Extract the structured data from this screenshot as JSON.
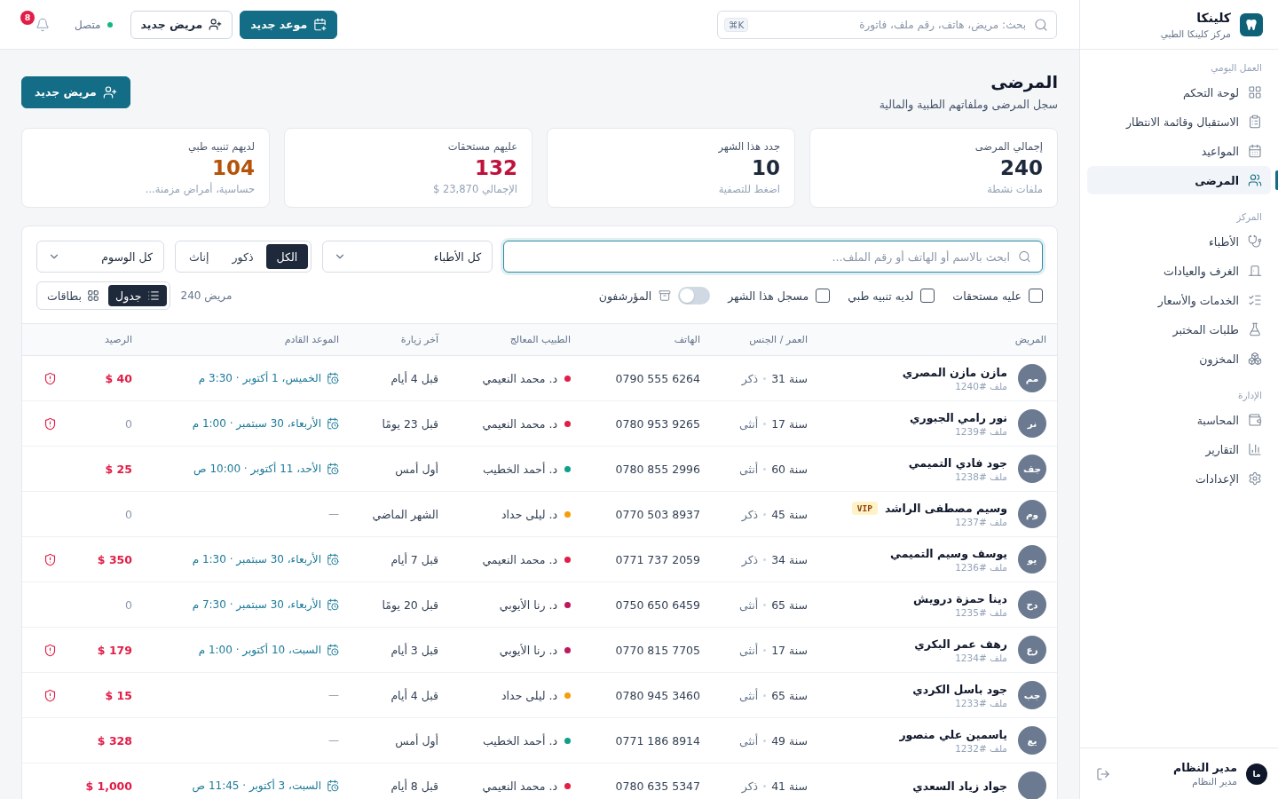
{
  "sidebar": {
    "brand": {
      "title": "كلينكا",
      "subtitle": "مركز كلينكا الطبي"
    },
    "sections": [
      {
        "title": "العمل اليومي",
        "items": [
          {
            "label": "لوحة التحكم",
            "selected": false
          },
          {
            "label": "الاستقبال وقائمة الانتظار",
            "selected": false
          },
          {
            "label": "المواعيد",
            "selected": false
          },
          {
            "label": "المرضى",
            "selected": true
          }
        ]
      },
      {
        "title": "المركز",
        "items": [
          {
            "label": "الأطباء",
            "selected": false
          },
          {
            "label": "الغرف والعيادات",
            "selected": false
          },
          {
            "label": "الخدمات والأسعار",
            "selected": false
          },
          {
            "label": "طلبات المختبر",
            "selected": false
          },
          {
            "label": "المخزون",
            "selected": false
          }
        ]
      },
      {
        "title": "الإدارة",
        "items": [
          {
            "label": "المحاسبة",
            "selected": false
          },
          {
            "label": "التقارير",
            "selected": false
          },
          {
            "label": "الإعدادات",
            "selected": false
          }
        ]
      }
    ],
    "user": {
      "initials": "ما",
      "name": "مدير النظام",
      "role": "مدير النظام"
    }
  },
  "topbar": {
    "search": {
      "placeholder": "بحث: مريض، هاتف، رقم ملف، فاتورة",
      "shortcut": "⌘K"
    },
    "buttons": [
      {
        "label": "موعد جديد",
        "kind": "primary"
      },
      {
        "label": "مريض جديد",
        "kind": "outline"
      }
    ],
    "status": {
      "label": "متصل",
      "online": true
    },
    "notifications": {
      "count": "8"
    }
  },
  "page": {
    "title": "المرضى",
    "subtitle": "سجل المرضى وملفاتهم الطبية والمالية",
    "action": {
      "label": "مريض جديد",
      "kind": "primary"
    }
  },
  "stats": [
    {
      "label": "إجمالي المرضى",
      "value": "240",
      "note": "ملفات نشطة",
      "color": "#1e293b"
    },
    {
      "label": "جدد هذا الشهر",
      "value": "10",
      "note": "اضغط للتصفية",
      "color": "#1e293b"
    },
    {
      "label": "عليهم مستحقات",
      "value": "132",
      "note": "الإجمالي 23,870 $",
      "color": "#be123c"
    },
    {
      "label": "لديهم تنبيه طبي",
      "value": "104",
      "note": "حساسية، أمراض مزمنة...",
      "color": "#b45309"
    }
  ],
  "filters": {
    "search": {
      "placeholder": "ابحث بالاسم أو الهاتف أو رقم الملف...",
      "focused": true
    },
    "doctor_select": {
      "value": "كل الأطباء"
    },
    "gender": [
      {
        "label": "الكل",
        "selected": true
      },
      {
        "label": "ذكور",
        "selected": false
      },
      {
        "label": "إناث",
        "selected": false
      }
    ],
    "tag_select": {
      "value": "كل الوسوم"
    },
    "checks": [
      {
        "label": "عليه مستحقات",
        "checked": false
      },
      {
        "label": "لديه تنبيه طبي",
        "checked": false
      },
      {
        "label": "مسجل هذا الشهر",
        "checked": false
      }
    ],
    "archived": {
      "label": "المؤرشفون",
      "on": false
    },
    "count": "240 مريض",
    "views": [
      {
        "label": "جدول",
        "selected": true
      },
      {
        "label": "بطاقات",
        "selected": false
      }
    ]
  },
  "table": {
    "columns": [
      "المريض",
      "العمر / الجنس",
      "الهاتف",
      "الطبيب المعالج",
      "آخر زيارة",
      "الموعد القادم",
      "الرصيد"
    ],
    "rows": [
      {
        "initials": "مم",
        "name": "مازن مازن المصري",
        "file": "ملف #1240",
        "age": "31 سنة",
        "gender": "ذكر",
        "phone": "0790 555 6264",
        "doctor": {
          "name": "د. محمد النعيمي",
          "color": "#e11d48"
        },
        "last_visit": "قبل 4 أيام",
        "appointment": "الخميس، 1 أكتوبر · 3:30 م",
        "scheduled": true,
        "balance": "$ 40",
        "due": true,
        "alert": true
      },
      {
        "initials": "نر",
        "name": "نور رامي الجبوري",
        "file": "ملف #1239",
        "age": "17 سنة",
        "gender": "أنثى",
        "phone": "0780 953 9265",
        "doctor": {
          "name": "د. محمد النعيمي",
          "color": "#e11d48"
        },
        "last_visit": "قبل 23 يومًا",
        "appointment": "الأربعاء، 30 سبتمبر · 1:00 م",
        "scheduled": true,
        "balance": "0",
        "due": false,
        "alert": true
      },
      {
        "initials": "جف",
        "name": "جود فادي التميمي",
        "file": "ملف #1238",
        "age": "60 سنة",
        "gender": "أنثى",
        "phone": "0780 855 2996",
        "doctor": {
          "name": "د. أحمد الخطيب",
          "color": "#0f9f8a"
        },
        "last_visit": "أول أمس",
        "appointment": "الأحد، 11 أكتوبر · 10:00 ص",
        "scheduled": true,
        "balance": "$ 25",
        "due": true,
        "alert": false
      },
      {
        "initials": "وم",
        "name": "وسيم مصطفى الراشد",
        "badge": "VIP",
        "file": "ملف #1237",
        "age": "45 سنة",
        "gender": "ذكر",
        "phone": "0770 503 8937",
        "doctor": {
          "name": "د. ليلى حداد",
          "color": "#f59e0b"
        },
        "last_visit": "الشهر الماضي",
        "appointment": "—",
        "scheduled": false,
        "balance": "0",
        "due": false,
        "alert": false
      },
      {
        "initials": "يو",
        "name": "يوسف وسيم التميمي",
        "file": "ملف #1236",
        "age": "34 سنة",
        "gender": "ذكر",
        "phone": "0771 737 2059",
        "doctor": {
          "name": "د. محمد النعيمي",
          "color": "#e11d48"
        },
        "last_visit": "قبل 7 أيام",
        "appointment": "الأربعاء، 30 سبتمبر · 1:30 م",
        "scheduled": true,
        "balance": "$ 350",
        "due": true,
        "alert": true
      },
      {
        "initials": "دح",
        "name": "دينا حمزة درويش",
        "file": "ملف #1235",
        "age": "65 سنة",
        "gender": "أنثى",
        "phone": "0750 650 6459",
        "doctor": {
          "name": "د. رنا الأيوبي",
          "color": "#be185d"
        },
        "last_visit": "قبل 20 يومًا",
        "appointment": "الأربعاء، 30 سبتمبر · 7:30 م",
        "scheduled": true,
        "balance": "0",
        "due": false,
        "alert": false
      },
      {
        "initials": "رع",
        "name": "رهف عمر البكري",
        "file": "ملف #1234",
        "age": "17 سنة",
        "gender": "أنثى",
        "phone": "0770 815 7705",
        "doctor": {
          "name": "د. رنا الأيوبي",
          "color": "#be185d"
        },
        "last_visit": "قبل 3 أيام",
        "appointment": "السبت، 10 أكتوبر · 1:00 م",
        "scheduled": true,
        "balance": "$ 179",
        "due": true,
        "alert": true
      },
      {
        "initials": "جب",
        "name": "جود باسل الكردي",
        "file": "ملف #1233",
        "age": "65 سنة",
        "gender": "أنثى",
        "phone": "0780 945 3460",
        "doctor": {
          "name": "د. ليلى حداد",
          "color": "#f59e0b"
        },
        "last_visit": "قبل 4 أيام",
        "appointment": "—",
        "scheduled": false,
        "balance": "$ 15",
        "due": true,
        "alert": true
      },
      {
        "initials": "يع",
        "name": "ياسمين علي منصور",
        "file": "ملف #1232",
        "age": "49 سنة",
        "gender": "أنثى",
        "phone": "0771 186 8914",
        "doctor": {
          "name": "د. أحمد الخطيب",
          "color": "#0f9f8a"
        },
        "last_visit": "أول أمس",
        "appointment": "—",
        "scheduled": false,
        "balance": "$ 328",
        "due": true,
        "alert": false
      },
      {
        "name": "جواد زياد السعدي",
        "age": "41 سنة",
        "gender": "ذكر",
        "phone": "0780 635 5347",
        "doctor": {
          "name": "د. محمد النعيمي",
          "color": "#e11d48"
        },
        "last_visit": "قبل 8 أيام",
        "appointment": "السبت، 3 أكتوبر · 11:45 ص",
        "scheduled": true,
        "balance": "$ 1,000",
        "due": true,
        "alert": false
      }
    ]
  }
}
